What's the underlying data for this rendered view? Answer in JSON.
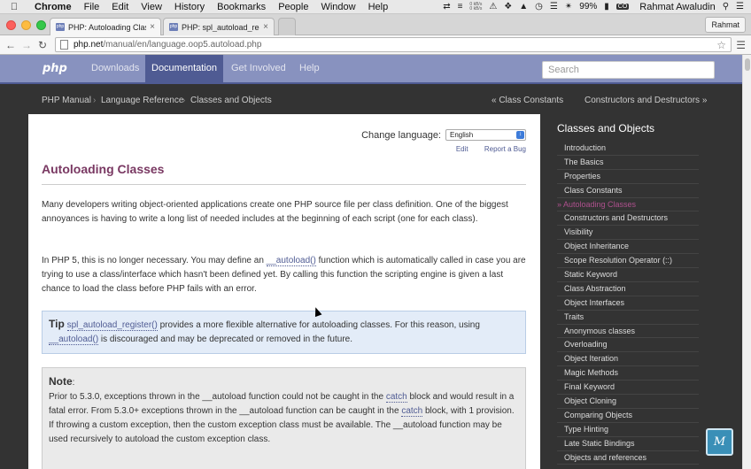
{
  "menubar": {
    "items": [
      "Chrome",
      "File",
      "Edit",
      "View",
      "History",
      "Bookmarks",
      "People",
      "Window",
      "Help"
    ],
    "netspeed_up": "0 kB/s",
    "netspeed_down": "0 kB/s",
    "battery": "99%",
    "user": "Rahmat Awaludin"
  },
  "browser": {
    "tabs": [
      {
        "title": "PHP: Autoloading Classes",
        "favicon": "php"
      },
      {
        "title": "PHP: spl_autoload_register",
        "favicon": "php"
      }
    ],
    "profile_button": "Rahmat",
    "url_host": "php.net",
    "url_path": "/manual/en/language.oop5.autoload.php"
  },
  "phpnav": {
    "logo": "php",
    "links": [
      "Downloads",
      "Documentation",
      "Get Involved",
      "Help"
    ],
    "search_placeholder": "Search"
  },
  "breadcrumb": {
    "items": [
      "PHP Manual",
      "Language Reference",
      "Classes and Objects"
    ],
    "prev": "« Class Constants",
    "next": "Constructors and Destructors »"
  },
  "main": {
    "change_language_label": "Change language:",
    "language": "English",
    "edit_link": "Edit",
    "bug_link": "Report a Bug",
    "title": "Autoloading Classes",
    "para1": "Many developers writing object-oriented applications create one PHP source file per class definition. One of the biggest annoyances is having to write a long list of needed includes at the beginning of each script (one for each class).",
    "para2_a": "In PHP 5, this is no longer necessary. You may define an ",
    "para2_fn": "__autoload()",
    "para2_b": " function which is automatically called in case you are trying to use a class/interface which hasn't been defined yet. By calling this function the scripting engine is given a last chance to load the class before PHP fails with an error.",
    "tip_label": "Tip",
    "tip_fn1": "spl_autoload_register()",
    "tip_a": " provides a more flexible alternative for autoloading classes. For this reason, using ",
    "tip_fn2": "__autoload()",
    "tip_b": " is discouraged and may be deprecated or removed in the future.",
    "note_label": "Note",
    "note_colon": ":",
    "note_a": "Prior to 5.3.0, exceptions thrown in the __autoload function could not be caught in the ",
    "note_catch1": "catch",
    "note_b": " block and would result in a fatal error. From 5.3.0+ exceptions thrown in the __autoload function can be caught in the ",
    "note_catch2": "catch",
    "note_c": " block, with 1 provision. If throwing a custom exception, then the custom exception class must be available. The __autoload function may be used recursively to autoload the custom exception class."
  },
  "sidebar": {
    "title": "Classes and Objects",
    "items": [
      "Introduction",
      "The Basics",
      "Properties",
      "Class Constants",
      "» Autoloading Classes",
      "Constructors and Destructors",
      "Visibility",
      "Object Inheritance",
      "Scope Resolution Operator (::)",
      "Static Keyword",
      "Class Abstraction",
      "Object Interfaces",
      "Traits",
      "Anonymous classes",
      "Overloading",
      "Object Iteration",
      "Magic Methods",
      "Final Keyword",
      "Object Cloning",
      "Comparing Objects",
      "Type Hinting",
      "Late Static Bindings",
      "Objects and references"
    ]
  },
  "colors": {
    "php_nav": "#8892bf",
    "php_nav_active": "#4f5b93",
    "title": "#793862",
    "current_item": "#ae508d"
  },
  "watermark": "M"
}
